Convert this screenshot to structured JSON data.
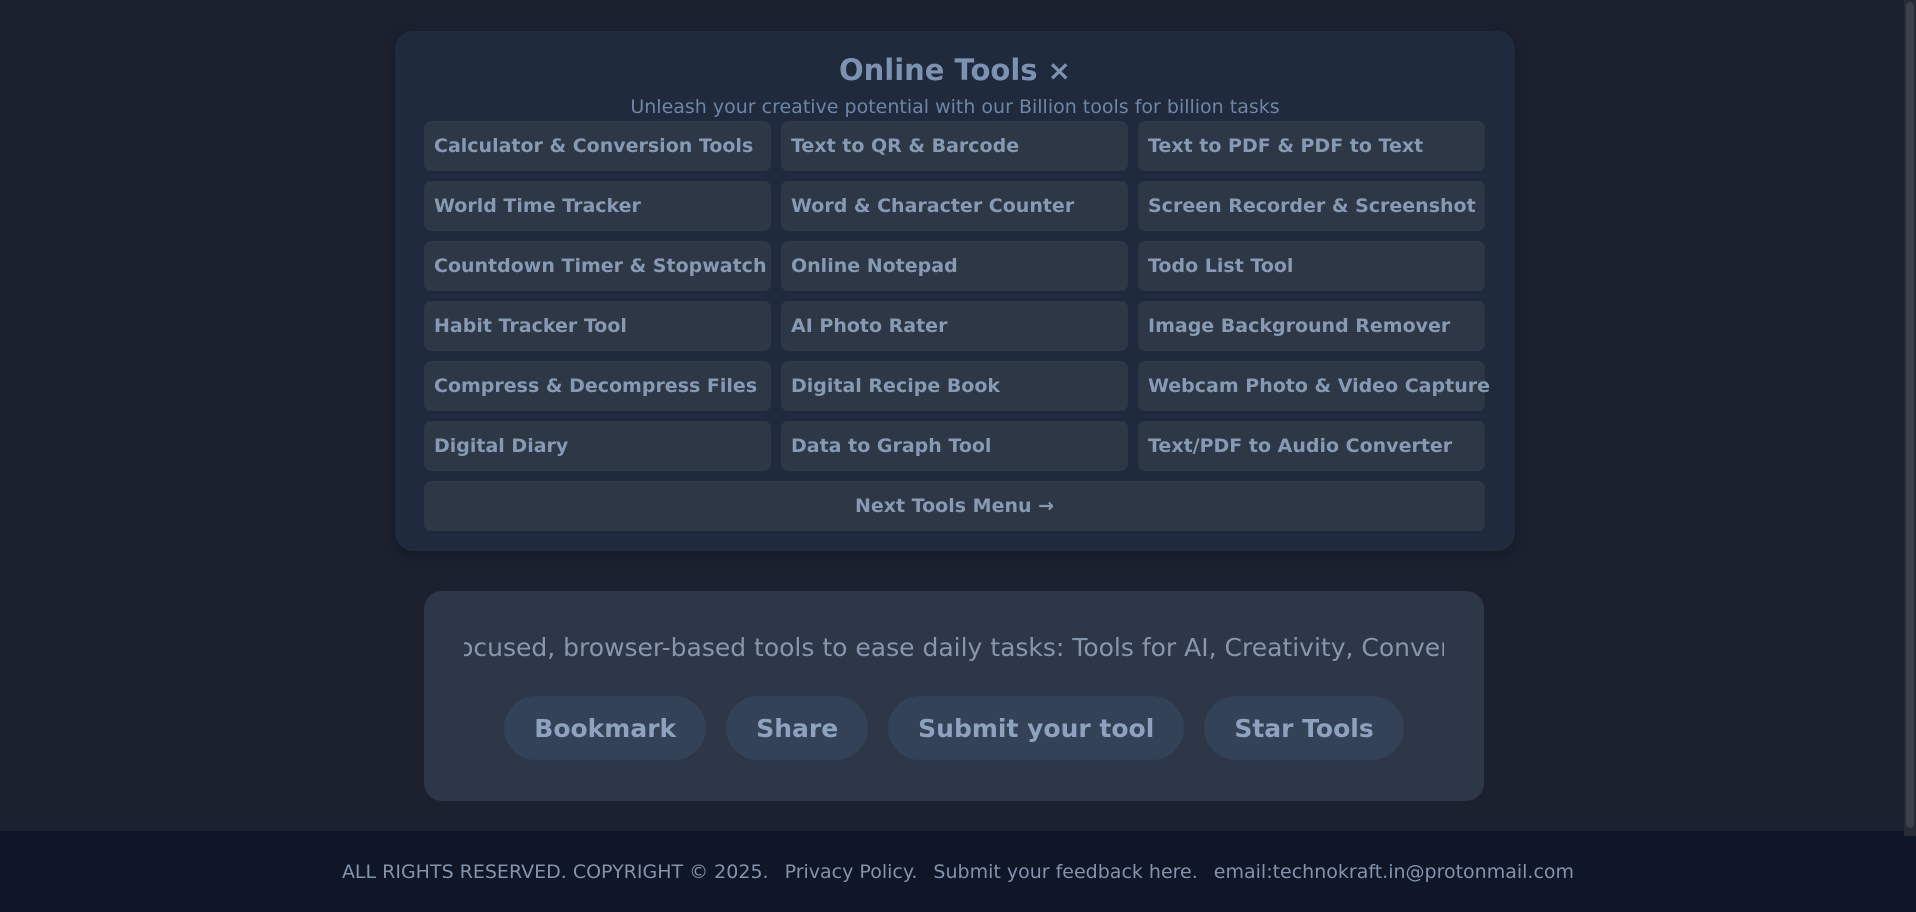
{
  "tools_panel": {
    "title": "Online Tools",
    "close_glyph": "×",
    "subtitle": "Unleash your creative potential with our Billion tools for billion tasks",
    "tools": [
      "Calculator & Conversion Tools",
      "Text to QR & Barcode",
      "Text to PDF & PDF to Text",
      "World Time Tracker",
      "Word & Character Counter",
      "Screen Recorder & Screenshot",
      "Countdown Timer & Stopwatch",
      "Online Notepad",
      "Todo List Tool",
      "Habit Tracker Tool",
      "AI Photo Rater",
      "Image Background Remover",
      "Compress & Decompress Files",
      "Digital Recipe Book",
      "Webcam Photo & Video Capture",
      "Digital Diary",
      "Data to Graph Tool",
      "Text/PDF to Audio Converter"
    ],
    "next_label": "Next Tools Menu →"
  },
  "info_card": {
    "marquee": "privacy-focused, browser-based tools to ease daily tasks: Tools for AI, Creativity, Conversion",
    "actions": [
      "Bookmark",
      "Share",
      "Submit your tool",
      "Star Tools"
    ]
  },
  "footer": {
    "copyright": "ALL RIGHTS RESERVED. COPYRIGHT © 2025.",
    "privacy": "Privacy Policy.",
    "feedback": "Submit your feedback here.",
    "email": "email:technokraft.in@protonmail.com"
  },
  "colors": {
    "page_bg": "#1c2130",
    "panel_bg": "#1f2a3d",
    "button_bg": "#2d3746",
    "text": "#8799b3",
    "footer_bg": "#0f1628"
  }
}
